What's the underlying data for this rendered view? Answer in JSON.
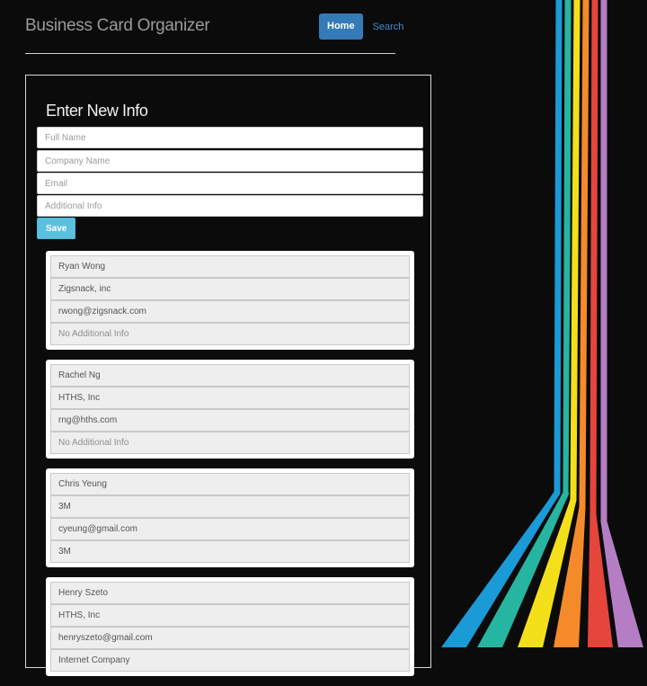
{
  "app": {
    "title": "Business Card Organizer"
  },
  "nav": {
    "home": "Home",
    "search": "Search"
  },
  "form": {
    "title": "Enter New Info",
    "full_name_placeholder": "Full Name",
    "company_placeholder": "Company Name",
    "email_placeholder": "Email",
    "additional_placeholder": "Additional Info",
    "save_label": "Save"
  },
  "cards": [
    {
      "name": "Ryan Wong",
      "company": "Zigsnack, inc",
      "email": "rwong@zigsnack.com",
      "info": "No Additional Info",
      "info_muted": true
    },
    {
      "name": "Rachel Ng",
      "company": "HTHS, Inc",
      "email": "rng@hths.com",
      "info": "No Additional Info",
      "info_muted": true
    },
    {
      "name": "Chris Yeung",
      "company": "3M",
      "email": "cyeung@gmail.com",
      "info": "3M",
      "info_muted": false
    },
    {
      "name": "Henry Szeto",
      "company": "HTHS, Inc",
      "email": "henryszeto@gmail.com",
      "info": "Internet Company",
      "info_muted": false
    }
  ],
  "theme": {
    "background": "#0b0b0b",
    "primary": "#337ab7",
    "info": "#5bc0de",
    "stripe_colors": [
      "#1a9ad6",
      "#26b5a0",
      "#f4e01a",
      "#f58a2a",
      "#e6453c",
      "#b57ec4"
    ]
  }
}
